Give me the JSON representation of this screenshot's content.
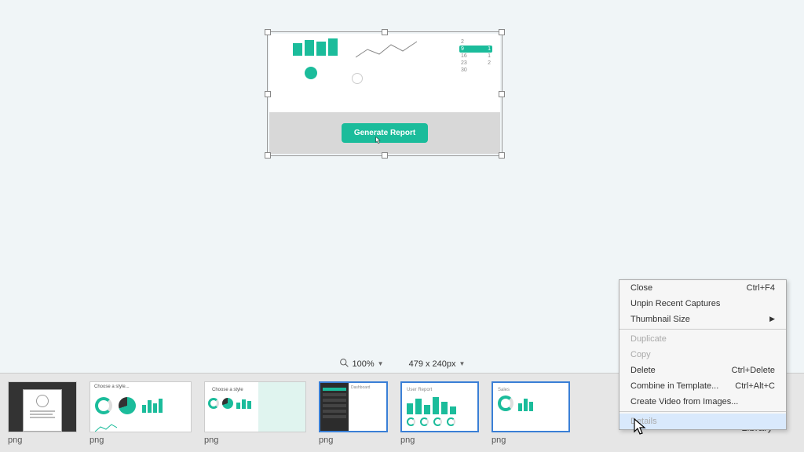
{
  "canvas": {
    "button_label": "Generate Report",
    "calendar": {
      "rows": [
        {
          "a": "2",
          "b": ""
        },
        {
          "a": "9",
          "b": "1",
          "selected": true
        },
        {
          "a": "16",
          "b": "1"
        },
        {
          "a": "23",
          "b": "2"
        },
        {
          "a": "30",
          "b": ""
        }
      ]
    }
  },
  "toolbar": {
    "zoom": "100%",
    "dimensions": "479 x 240px"
  },
  "tray": {
    "items": [
      {
        "ext": "png",
        "caption": "",
        "type": "profile"
      },
      {
        "ext": "png",
        "caption": "Choose a style...",
        "type": "style"
      },
      {
        "ext": "png",
        "caption": "",
        "type": "style2"
      },
      {
        "ext": "png",
        "caption": "Dashboard",
        "type": "dashboard"
      },
      {
        "ext": "png",
        "caption": "User Report",
        "type": "report"
      },
      {
        "ext": "png",
        "caption": "Sales",
        "type": "sales"
      }
    ],
    "library_label": "Library"
  },
  "context_menu": {
    "items": [
      {
        "label": "Close",
        "shortcut": "Ctrl+F4",
        "disabled": false
      },
      {
        "label": "Unpin Recent Captures",
        "shortcut": "",
        "disabled": false
      },
      {
        "label": "Thumbnail Size",
        "shortcut": "",
        "submenu": true,
        "disabled": false
      },
      {
        "sep": true
      },
      {
        "label": "Duplicate",
        "shortcut": "",
        "disabled": true
      },
      {
        "label": "Copy",
        "shortcut": "",
        "disabled": true
      },
      {
        "label": "Delete",
        "shortcut": "Ctrl+Delete",
        "disabled": false
      },
      {
        "label": "Combine in Template...",
        "shortcut": "Ctrl+Alt+C",
        "disabled": false
      },
      {
        "label": "Create Video from Images...",
        "shortcut": "",
        "disabled": false
      },
      {
        "sep": true
      },
      {
        "label": "Details",
        "shortcut": "",
        "disabled": true,
        "hover": true
      }
    ]
  }
}
